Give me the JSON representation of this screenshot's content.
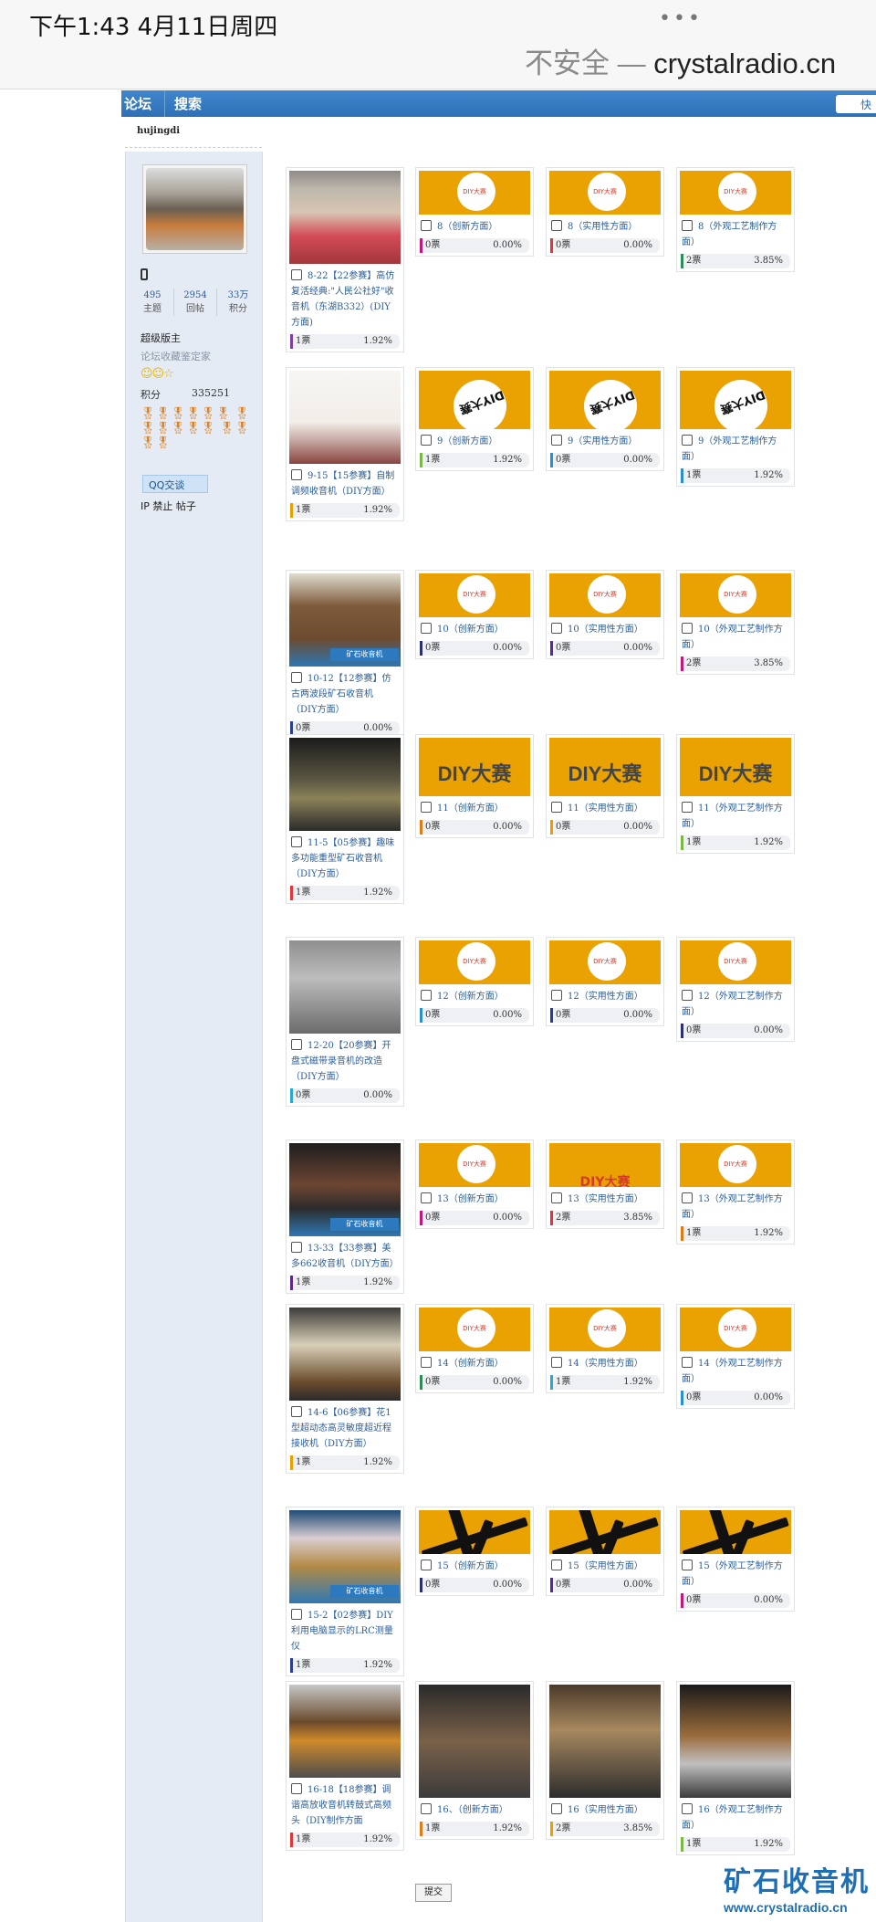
{
  "status": {
    "time": "下午1:43   4月11日周四",
    "dots": "•••",
    "url_insecure": "不安全 — ",
    "url_host": "crystalradio.cn"
  },
  "nav": {
    "forum": "论坛",
    "search": "搜索",
    "right": "快"
  },
  "author": {
    "name": "hujingdi",
    "stats": [
      {
        "value": "495",
        "label": "主题"
      },
      {
        "value": "2954",
        "label": "回帖"
      },
      {
        "value": "33万",
        "label": "积分"
      }
    ],
    "rank": "超级版主",
    "honor": "论坛收藏鉴定家",
    "stars": "☺☺☆",
    "credits_label": "积分",
    "credits_value": "335251",
    "medals": "🎖🎖🎖🎖🎖🎖 🎖🎖🎖🎖🎖🎖 🎖🎖🎖🎖",
    "qq": "QQ交谈",
    "ip": "IP 禁止 帖子"
  },
  "rows": [
    {
      "main": {
        "label": "8-22【22参赛】高仿复活经典:\"人民公社好\"收音机（东湖B332）(DIY方面)",
        "votes": "1票",
        "pct": "1.92%",
        "color": "#7b3fa0"
      },
      "subs": [
        {
          "label": "8（创新方面）",
          "votes": "0票",
          "pct": "0.00%",
          "color": "#c2187a"
        },
        {
          "label": "8（实用性方面）",
          "votes": "0票",
          "pct": "0.00%",
          "color": "#e0363a"
        },
        {
          "label": "8（外观工艺制作方面）",
          "votes": "2票",
          "pct": "3.85%",
          "color": "#2e8b57"
        }
      ]
    },
    {
      "main": {
        "label": "9-15【15参赛】自制调频收音机（DIY方面）",
        "votes": "1票",
        "pct": "1.92%",
        "color": "#e6a100"
      },
      "subs": [
        {
          "label": "9（创新方面）",
          "votes": "1票",
          "pct": "1.92%",
          "color": "#7ab648"
        },
        {
          "label": "9（实用性方面）",
          "votes": "0票",
          "pct": "0.00%",
          "color": "#2a8fcf"
        },
        {
          "label": "9（外观工艺制作方面）",
          "votes": "1票",
          "pct": "1.92%",
          "color": "#2a8fcf"
        }
      ]
    },
    {
      "main": {
        "label": "10-12【12参赛】仿古两波段矿石收音机（DIY方面）",
        "votes": "0票",
        "pct": "0.00%",
        "color": "#2a3f8f"
      },
      "subs": [
        {
          "label": "10（创新方面）",
          "votes": "0票",
          "pct": "0.00%",
          "color": "#2a2f6f"
        },
        {
          "label": "10（实用性方面）",
          "votes": "0票",
          "pct": "0.00%",
          "color": "#5a2a8f"
        },
        {
          "label": "10（外观工艺制作方面）",
          "votes": "2票",
          "pct": "3.85%",
          "color": "#c2187a"
        }
      ]
    },
    {
      "main": {
        "label": "11-5【05参赛】趣味多功能重型矿石收音机（DIY方面）",
        "votes": "1票",
        "pct": "1.92%",
        "color": "#e0363a"
      },
      "subs": [
        {
          "label": "11（创新方面）",
          "votes": "0票",
          "pct": "0.00%",
          "color": "#e07b1a"
        },
        {
          "label": "11（实用性方面）",
          "votes": "0票",
          "pct": "0.00%",
          "color": "#e6a100"
        },
        {
          "label": "11（外观工艺制作方面）",
          "votes": "1票",
          "pct": "1.92%",
          "color": "#7ab648"
        }
      ]
    },
    {
      "main": {
        "label": "12-20【20参赛】开盘式磁带录音机的改造（DIY方面）",
        "votes": "0票",
        "pct": "0.00%",
        "color": "#2aa8cf"
      },
      "subs": [
        {
          "label": "12（创新方面）",
          "votes": "0票",
          "pct": "0.00%",
          "color": "#2a8fcf"
        },
        {
          "label": "12（实用性方面）",
          "votes": "0票",
          "pct": "0.00%",
          "color": "#2a3f8f"
        },
        {
          "label": "12（外观工艺制作方面）",
          "votes": "0票",
          "pct": "0.00%",
          "color": "#2a2f6f"
        }
      ]
    },
    {
      "main": {
        "label": "13-33【33参赛】美多662收音机（DIY方面）",
        "votes": "1票",
        "pct": "1.92%",
        "color": "#5a2a8f"
      },
      "subs": [
        {
          "label": "13（创新方面）",
          "votes": "0票",
          "pct": "0.00%",
          "color": "#c2187a"
        },
        {
          "label": "13（实用性方面）",
          "votes": "2票",
          "pct": "3.85%",
          "color": "#e0363a"
        },
        {
          "label": "13（外观工艺制作方面）",
          "votes": "1票",
          "pct": "1.92%",
          "color": "#e07b1a"
        }
      ]
    },
    {
      "main": {
        "label": "14-6【06参赛】花1型超动态高灵敏度超近程接收机（DIY方面）",
        "votes": "1票",
        "pct": "1.92%",
        "color": "#e6a100"
      },
      "subs": [
        {
          "label": "14（创新方面）",
          "votes": "0票",
          "pct": "0.00%",
          "color": "#2e8b57"
        },
        {
          "label": "14（实用性方面）",
          "votes": "1票",
          "pct": "1.92%",
          "color": "#2aa8cf"
        },
        {
          "label": "14（外观工艺制作方面）",
          "votes": "0票",
          "pct": "0.00%",
          "color": "#2a8fcf"
        }
      ]
    },
    {
      "main": {
        "label": "15-2【02参赛】DIY利用电脑显示的LRC测量仪",
        "votes": "1票",
        "pct": "1.92%",
        "color": "#2a3f8f"
      },
      "subs": [
        {
          "label": "15（创新方面）",
          "votes": "0票",
          "pct": "0.00%",
          "color": "#2a2f6f"
        },
        {
          "label": "15（实用性方面）",
          "votes": "0票",
          "pct": "0.00%",
          "color": "#5a2a8f"
        },
        {
          "label": "15（外观工艺制作方面）",
          "votes": "0票",
          "pct": "0.00%",
          "color": "#c2187a"
        }
      ]
    },
    {
      "main": {
        "label": "16-18【18参赛】调谐高放收音机转鼓式高频头（DIY制作方面",
        "votes": "1票",
        "pct": "1.92%",
        "color": "#e0363a"
      },
      "subs": [
        {
          "label": "16、（创新方面）",
          "votes": "1票",
          "pct": "1.92%",
          "color": "#e07b1a"
        },
        {
          "label": "16（实用性方面）",
          "votes": "2票",
          "pct": "3.85%",
          "color": "#e6a100"
        },
        {
          "label": "16（外观工艺制作方面）",
          "votes": "1票",
          "pct": "1.92%",
          "color": "#7ab648"
        }
      ]
    }
  ],
  "submit": "提交",
  "watermark": {
    "title": "矿石收音机",
    "url": "www.crystalradio.cn",
    "logo_small": "矿石收音机"
  },
  "thumb_text": {
    "diy": "DIY大赛",
    "diy_small": "DIY大赛"
  }
}
